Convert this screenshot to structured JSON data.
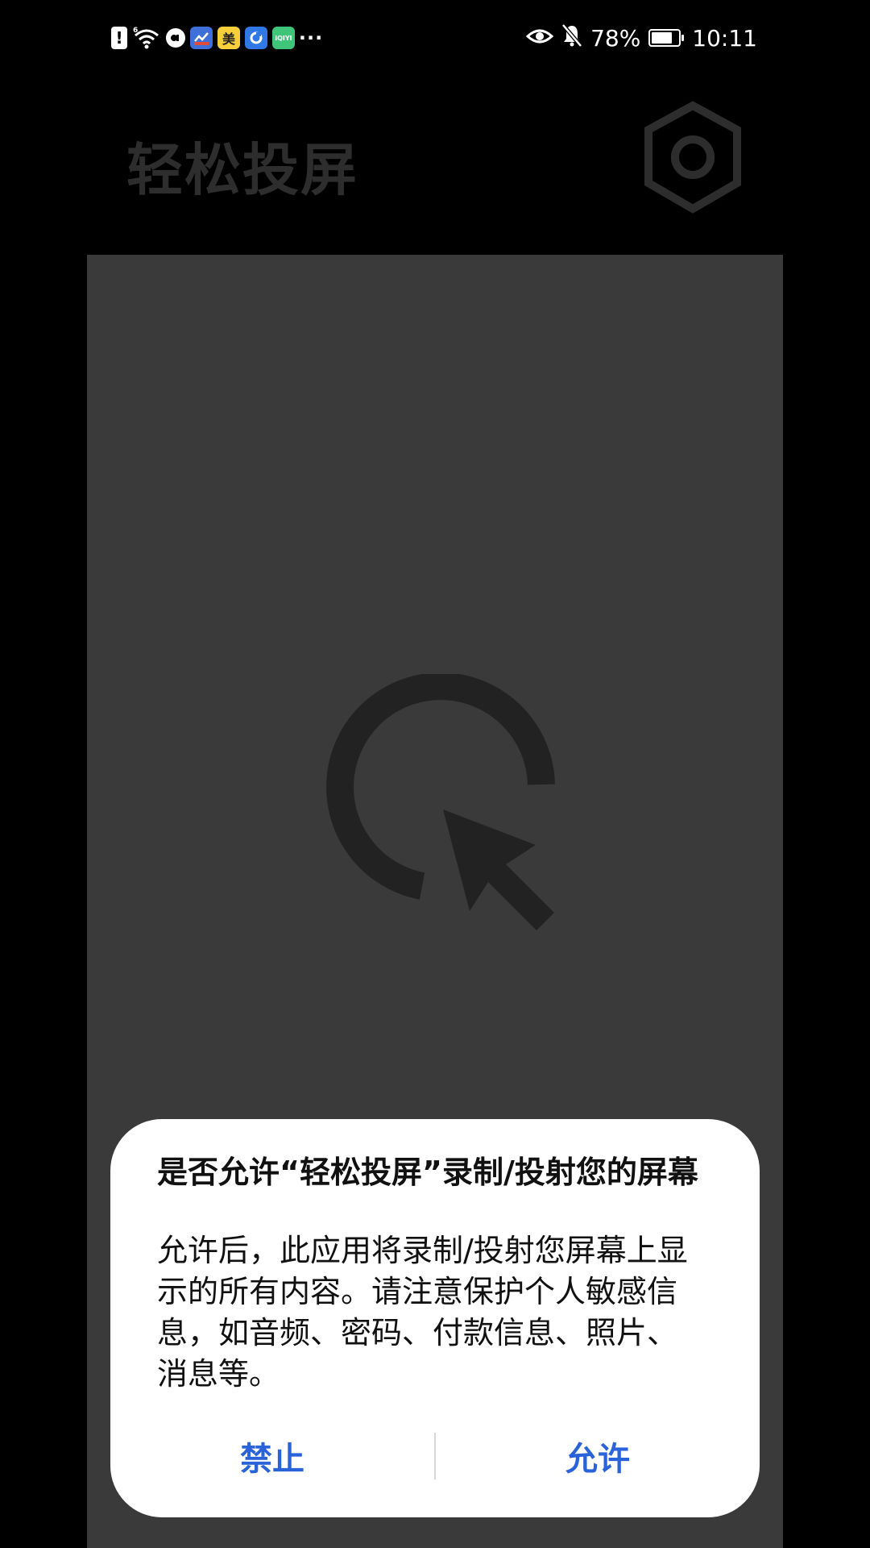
{
  "status_bar": {
    "time": "10:11",
    "battery_percent": "78%",
    "battery_level": 0.78,
    "left_icons": [
      "alert-icon",
      "wifi-icon",
      "app-icon-1",
      "app-icon-2",
      "app-icon-mei",
      "app-icon-4",
      "app-icon-iqiyi",
      "more-dots-icon"
    ],
    "mei_label": "美",
    "iqiyi_label": "iQIYI",
    "more_label": "···",
    "signal_label": "6",
    "right_icons": [
      "eye-icon",
      "bell-off-icon",
      "battery-icon"
    ]
  },
  "app": {
    "title": "轻松投屏"
  },
  "dialog": {
    "title": "是否允许“轻松投屏”录制/投射您的屏幕",
    "body_lines": [
      "允许后，此应用将录制/投射您屏幕上显",
      "示的所有内容。请注意保护个人敏感信",
      "息，如音频、密码、付款信息、照片、",
      "消息等。"
    ],
    "deny_label": "禁止",
    "allow_label": "允许"
  },
  "colors": {
    "background": "#000000",
    "panel": "#3a3a3a",
    "dim_text": "#2d2d2d",
    "dialog_bg": "#ffffff",
    "accent": "#2a63d9"
  }
}
